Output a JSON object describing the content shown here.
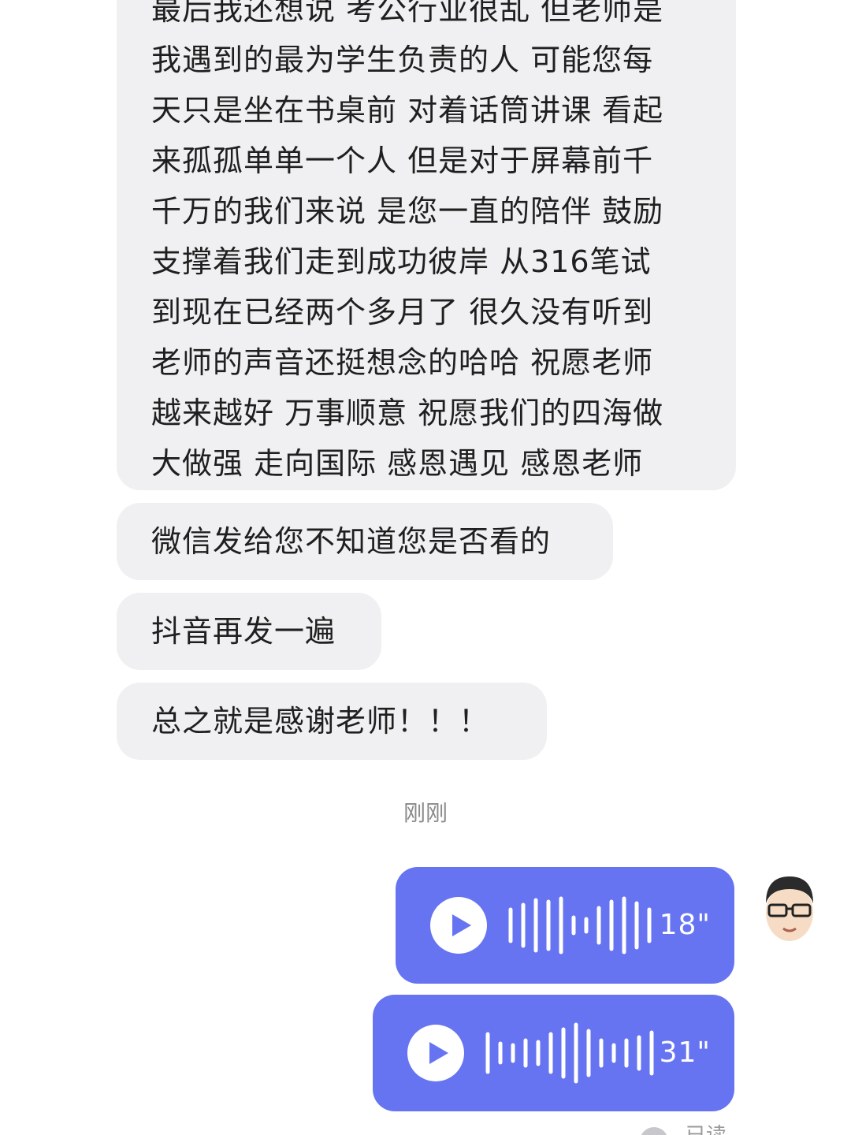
{
  "chat": {
    "incoming": {
      "long_message_lines": [
        "最后我还想说 考公行业很乱 但老师是",
        "我遇到的最为学生负责的人 可能您每",
        "天只是坐在书桌前 对着话筒讲课 看起",
        "来孤孤单单一个人  但是对于屏幕前千",
        "千万的我们来说 是您一直的陪伴 鼓励",
        "支撑着我们走到成功彼岸 从316笔试",
        "到现在已经两个多月了 很久没有听到",
        "老师的声音还挺想念的哈哈 祝愿老师",
        "越来越好 万事顺意 祝愿我们的四海做",
        "大做强 走向国际 感恩遇见 感恩老师"
      ],
      "msg_2": "微信发给您不知道您是否看的",
      "msg_3": "抖音再发一遍",
      "msg_4": "总之就是感谢老师！！！"
    },
    "timestamp": "刚刚",
    "outgoing": {
      "voice_1": {
        "duration": "18\"",
        "icon": "play-icon"
      },
      "voice_2": {
        "duration": "31\"",
        "icon": "play-icon"
      }
    },
    "read_status": "已读"
  },
  "colors": {
    "incoming_bubble": "#f0f0f2",
    "voice_bubble": "#6674f2",
    "timestamp_text": "#8a8a8a"
  }
}
